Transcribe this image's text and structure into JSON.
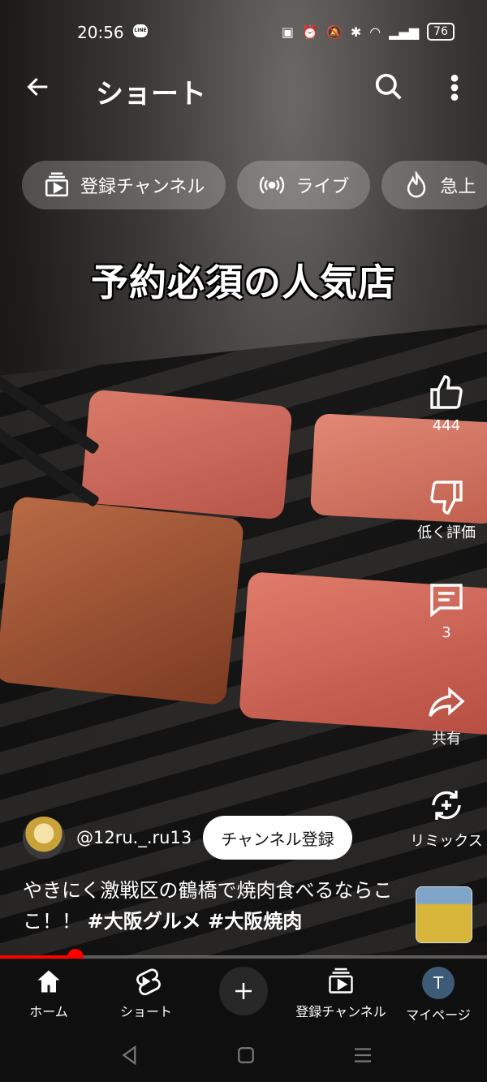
{
  "status_bar": {
    "time": "20:56",
    "battery": "76",
    "line_badge": "LINE"
  },
  "topbar": {
    "title": "ショート"
  },
  "chips": [
    {
      "label": "登録チャンネル",
      "icon": "subscriptions-icon"
    },
    {
      "label": "ライブ",
      "icon": "live-icon"
    },
    {
      "label": "急上",
      "icon": "trending-icon"
    }
  ],
  "video": {
    "overlay_text": "予約必須の人気店"
  },
  "actions": {
    "like_count": "444",
    "dislike_label": "低く評価",
    "comment_count": "3",
    "share_label": "共有",
    "remix_label": "リミックス"
  },
  "channel": {
    "handle": "@12ru._.ru13",
    "subscribe_label": "チャンネル登録"
  },
  "caption": {
    "text": "やきにく激戦区の鶴橋で焼肉食べるならここ！！",
    "tags": "#大阪グルメ #大阪焼肉"
  },
  "progress": {
    "fraction": 0.155
  },
  "bottom_nav": {
    "home": "ホーム",
    "shorts": "ショート",
    "subscriptions": "登録チャンネル",
    "mypage": "マイページ",
    "mypage_initial": "T"
  },
  "colors": {
    "accent": "#ff0000",
    "nav_bg": "#0f0f0f"
  }
}
